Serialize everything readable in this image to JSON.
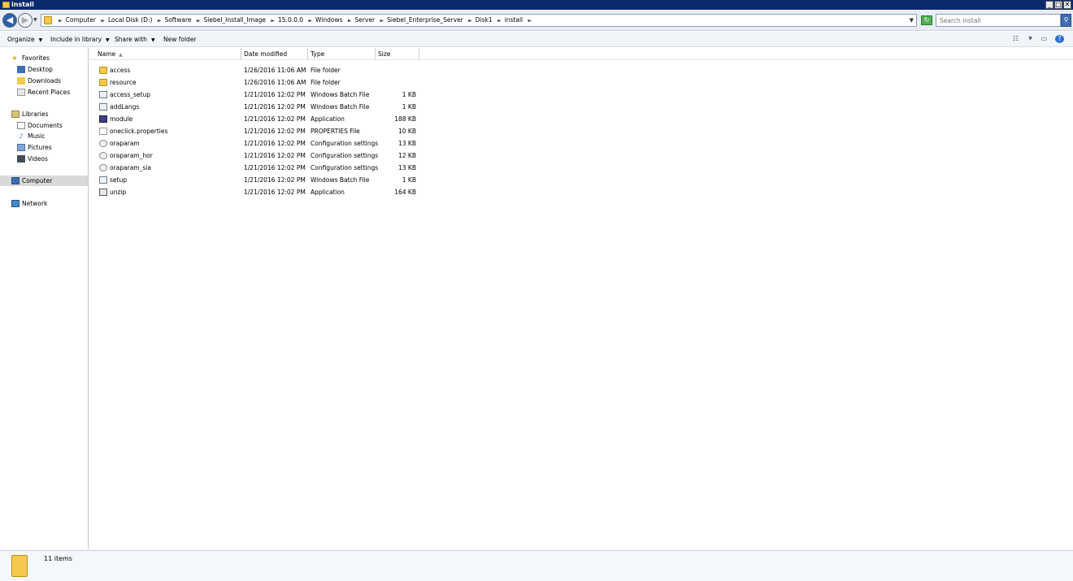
{
  "window": {
    "title": "install",
    "controls": {
      "minimize": "_",
      "maximize": "□",
      "close": "✕"
    }
  },
  "address": {
    "crumbs": [
      "Computer",
      "Local Disk (D:)",
      "Software",
      "Siebel_Install_Image",
      "15.0.0.0",
      "Windows",
      "Server",
      "Siebel_Enterprise_Server",
      "Disk1",
      "install"
    ],
    "search_placeholder": "Search install"
  },
  "toolbar": {
    "organize": "Organize",
    "include_in_library": "Include in library",
    "share_with": "Share with",
    "new_folder": "New folder"
  },
  "nav": {
    "favorites": "Favorites",
    "desktop": "Desktop",
    "downloads": "Downloads",
    "recent_places": "Recent Places",
    "libraries": "Libraries",
    "documents": "Documents",
    "music": "Music",
    "pictures": "Pictures",
    "videos": "Videos",
    "computer": "Computer",
    "network": "Network"
  },
  "columns": {
    "name": "Name",
    "date_modified": "Date modified",
    "type": "Type",
    "size": "Size"
  },
  "files": [
    {
      "name": "access",
      "date": "1/26/2016 11:06 AM",
      "type": "File folder",
      "size": "",
      "icon": "folder-icon"
    },
    {
      "name": "resource",
      "date": "1/26/2016 11:06 AM",
      "type": "File folder",
      "size": "",
      "icon": "folder-icon"
    },
    {
      "name": "access_setup",
      "date": "1/21/2016 12:02 PM",
      "type": "Windows Batch File",
      "size": "1 KB",
      "icon": "batch-file-icon"
    },
    {
      "name": "addLangs",
      "date": "1/21/2016 12:02 PM",
      "type": "Windows Batch File",
      "size": "1 KB",
      "icon": "batch-file-icon"
    },
    {
      "name": "module",
      "date": "1/21/2016 12:02 PM",
      "type": "Application",
      "size": "188 KB",
      "icon": "application-icon"
    },
    {
      "name": "oneclick.properties",
      "date": "1/21/2016 12:02 PM",
      "type": "PROPERTIES File",
      "size": "10 KB",
      "icon": "properties-file-icon"
    },
    {
      "name": "oraparam",
      "date": "1/21/2016 12:02 PM",
      "type": "Configuration settings",
      "size": "13 KB",
      "icon": "config-file-icon"
    },
    {
      "name": "oraparam_hor",
      "date": "1/21/2016 12:02 PM",
      "type": "Configuration settings",
      "size": "12 KB",
      "icon": "config-file-icon"
    },
    {
      "name": "oraparam_sia",
      "date": "1/21/2016 12:02 PM",
      "type": "Configuration settings",
      "size": "13 KB",
      "icon": "config-file-icon"
    },
    {
      "name": "setup",
      "date": "1/21/2016 12:02 PM",
      "type": "Windows Batch File",
      "size": "1 KB",
      "icon": "batch-file-icon"
    },
    {
      "name": "unzip",
      "date": "1/21/2016 12:02 PM",
      "type": "Application",
      "size": "164 KB",
      "icon": "application-icon"
    }
  ],
  "details": {
    "item_count": "11 items"
  }
}
